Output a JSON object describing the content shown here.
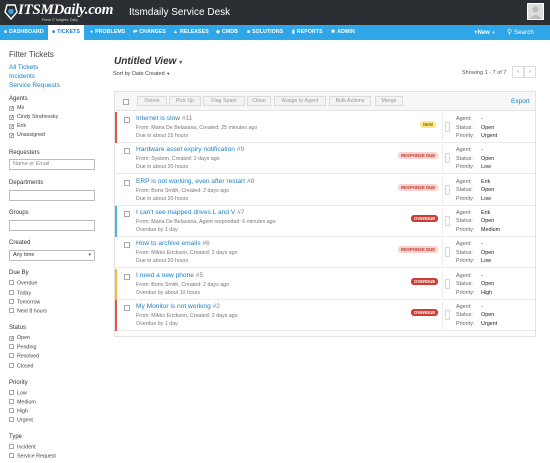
{
  "brand": {
    "logo_text": "ITSMDaily.com",
    "logo_sub": "Fresh IT Insights, Daily",
    "accent": "#2fa6e8",
    "header_bg": "#2b2f33"
  },
  "app_title": "Itsmdaily Service Desk",
  "nav": {
    "items": [
      {
        "label": "DASHBOARD",
        "icon": "home-icon"
      },
      {
        "label": "TICKETS",
        "icon": "ticket-icon"
      },
      {
        "label": "PROBLEMS",
        "icon": "problem-icon"
      },
      {
        "label": "CHANGES",
        "icon": "changes-icon"
      },
      {
        "label": "RELEASES",
        "icon": "release-icon"
      },
      {
        "label": "CMDB",
        "icon": "cmdb-icon"
      },
      {
        "label": "SOLUTIONS",
        "icon": "solutions-icon"
      },
      {
        "label": "REPORTS",
        "icon": "reports-icon"
      },
      {
        "label": "ADMIN",
        "icon": "admin-icon"
      }
    ],
    "new_label": "+New",
    "search_label": "Search"
  },
  "sidebar": {
    "title": "Filter Tickets",
    "links": [
      "All Tickets",
      "Incidents",
      "Service Requests"
    ],
    "agents": {
      "label": "Agents",
      "options": [
        {
          "label": "Me",
          "checked": true
        },
        {
          "label": "Cindy Strahovsky",
          "checked": true
        },
        {
          "label": "Erik",
          "checked": true
        },
        {
          "label": "Unassigned",
          "checked": true
        }
      ]
    },
    "requesters": {
      "label": "Requesters",
      "placeholder": "Name or Email"
    },
    "departments": {
      "label": "Departments"
    },
    "groups": {
      "label": "Groups"
    },
    "created": {
      "label": "Created",
      "value": "Any time"
    },
    "due_by": {
      "label": "Due By",
      "options": [
        {
          "label": "Overdue",
          "checked": false
        },
        {
          "label": "Today",
          "checked": false
        },
        {
          "label": "Tomorrow",
          "checked": false
        },
        {
          "label": "Next 8 hours",
          "checked": false
        }
      ]
    },
    "status": {
      "label": "Status",
      "options": [
        {
          "label": "Open",
          "checked": true
        },
        {
          "label": "Pending",
          "checked": false
        },
        {
          "label": "Resolved",
          "checked": false
        },
        {
          "label": "Closed",
          "checked": false
        }
      ]
    },
    "priority": {
      "label": "Priority",
      "options": [
        {
          "label": "Low",
          "checked": false
        },
        {
          "label": "Medium",
          "checked": false
        },
        {
          "label": "High",
          "checked": false
        },
        {
          "label": "Urgent",
          "checked": false
        }
      ]
    },
    "type": {
      "label": "Type",
      "options": [
        {
          "label": "Incident",
          "checked": false
        },
        {
          "label": "Service Request",
          "checked": false
        }
      ]
    }
  },
  "main": {
    "view_title": "Untitled View",
    "sort_label": "Sort by Date Created",
    "showing": "Showing 1 - 7 of 7",
    "toolbar": [
      "Delete",
      "Pick Up",
      "Flag Spam",
      "Close",
      "Assign to Agent",
      "Bulk Actions",
      "Merge"
    ],
    "export_label": "Export",
    "prop_labels": {
      "agent": "Agent:",
      "status": "Status:",
      "priority": "Priority:"
    },
    "tickets": [
      {
        "subject": "Internet is slow",
        "num": "#11",
        "meta": "From: Maria De Belasana, Created: 25 minutes ago",
        "due": "Due in about 15 hours",
        "badge": "NEW",
        "badge_type": "new",
        "stripe": "#e2574c",
        "agent": "-",
        "status": "Open",
        "priority": "Urgent"
      },
      {
        "subject": "Hardware asset expiry notification",
        "num": "#9",
        "meta": "From: System, Created: 2 days ago",
        "due": "Due in about 20 hours",
        "badge": "RESPONSE DUE",
        "badge_type": "resp",
        "stripe": "",
        "agent": "-",
        "status": "Open",
        "priority": "Low"
      },
      {
        "subject": "ERP is not working, even after restart",
        "num": "#8",
        "meta": "From: Boris Smith, Created: 2 days ago",
        "due": "Due in about 20 hours",
        "badge": "RESPONSE DUE",
        "badge_type": "resp",
        "stripe": "",
        "agent": "Erik",
        "status": "Open",
        "priority": "Low"
      },
      {
        "subject": "I can't see mapped drives L and V",
        "num": "#7",
        "meta": "From: Maria De Belasana, Agent responded: 6 minutes ago",
        "due": "Overdue by 1 day",
        "badge": "OVERDUE",
        "badge_type": "over",
        "stripe": "#45b9d6",
        "agent": "Erik",
        "status": "Open",
        "priority": "Medium"
      },
      {
        "subject": "How to archive emails",
        "num": "#6",
        "meta": "From: Mikko Erickson, Created: 2 days ago",
        "due": "Due in about 20 hours",
        "badge": "RESPONSE DUE",
        "badge_type": "resp",
        "stripe": "",
        "agent": "-",
        "status": "Open",
        "priority": "Low"
      },
      {
        "subject": "I need a new phone",
        "num": "#5",
        "meta": "From: Boris Smith, Created: 2 days ago",
        "due": "Overdue by about 10 hours",
        "badge": "OVERDUE",
        "badge_type": "over",
        "stripe": "#f5b93b",
        "agent": "-",
        "status": "Open",
        "priority": "High"
      },
      {
        "subject": "My Monitor is not working",
        "num": "#2",
        "meta": "From: Mikko Erickson, Created: 2 days ago",
        "due": "Overdue by 1 day",
        "badge": "OVERDUE",
        "badge_type": "over",
        "stripe": "#e2574c",
        "agent": "-",
        "status": "Open",
        "priority": "Urgent"
      }
    ]
  }
}
